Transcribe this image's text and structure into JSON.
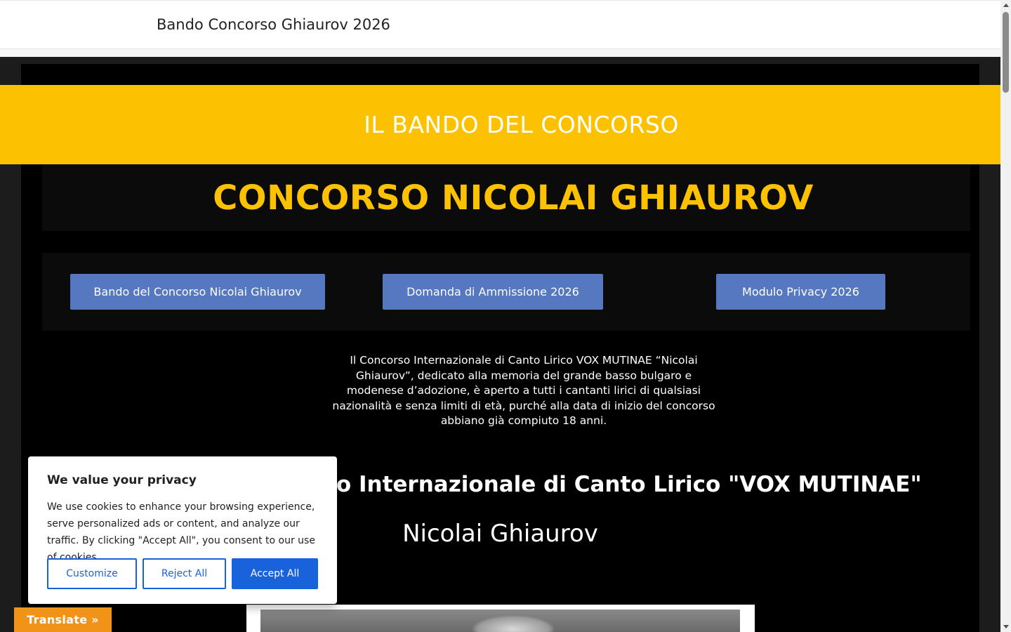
{
  "header": {
    "title": "Bando Concorso Ghiaurov 2026"
  },
  "banner": {
    "text": "IL BANDO DEL CONCORSO"
  },
  "headline": {
    "text": "CONCORSO NICOLAI GHIAUROV"
  },
  "buttons": [
    {
      "label": "Bando del Concorso Nicolai Ghiaurov"
    },
    {
      "label": "Domanda di Ammissione 2026"
    },
    {
      "label": "Modulo Privacy 2026"
    }
  ],
  "intro": {
    "text": "Il Concorso Internazionale di Canto Lirico VOX MUTINAE “Nicolai Ghiaurov”, dedicato alla memoria del grande basso bulgaro e modenese d’adozione, è aperto a tutti i cantanti lirici di qualsiasi nazionalità e senza limiti di età, purché alla data di inizio del concorso abbiano già compiuto 18 anni."
  },
  "section": {
    "heading": "Concorso Internazionale di Canto Lirico \"VOX MUTINAE\"",
    "subheading": "Nicolai Ghiaurov"
  },
  "cookie_banner": {
    "title": "We value your privacy",
    "body": "We use cookies to enhance your browsing experience, serve personalized ads or content, and analyze our traffic. By clicking \"Accept All\", you consent to our use of cookies.",
    "customize": "Customize",
    "reject": "Reject All",
    "accept": "Accept All"
  },
  "translate": {
    "label": "Translate »"
  },
  "colors": {
    "accent_yellow": "#fcc201",
    "button_blue": "#5578c0",
    "cookie_blue": "#1863dc",
    "translate_orange": "#f29319"
  }
}
